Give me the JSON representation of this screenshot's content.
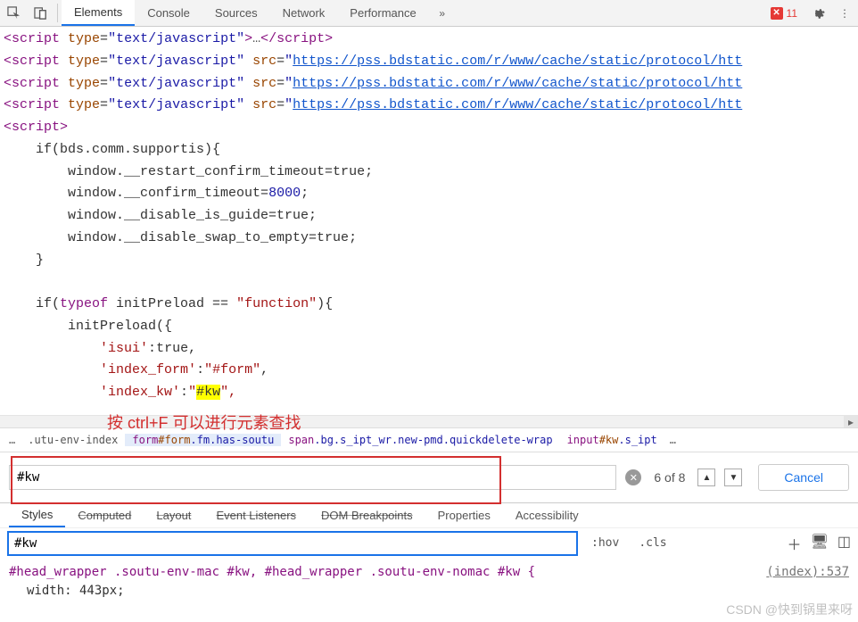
{
  "toolbar": {
    "tabs": [
      "Elements",
      "Console",
      "Sources",
      "Network",
      "Performance"
    ],
    "active_tab": 0,
    "errors": "11"
  },
  "code": {
    "lines": [
      {
        "t": "scriptjs",
        "ell": true,
        "src": null
      },
      {
        "t": "scriptjs",
        "src": "https://pss.bdstatic.com/r/www/cache/static/protocol/htt"
      },
      {
        "t": "scriptjs",
        "src": "https://pss.bdstatic.com/r/www/cache/static/protocol/htt"
      },
      {
        "t": "scriptjs",
        "src": "https://pss.bdstatic.com/r/www/cache/static/protocol/htt"
      },
      {
        "t": "scriptopen"
      },
      {
        "t": "js",
        "txt": "    if(bds.comm.supportis){"
      },
      {
        "t": "js",
        "txt": "        window.__restart_confirm_timeout=true;"
      },
      {
        "t": "js",
        "txt": "        window.__confirm_timeout=",
        "num": "8000",
        "after": ";"
      },
      {
        "t": "js",
        "txt": "        window.__disable_is_guide=true;"
      },
      {
        "t": "js",
        "txt": "        window.__disable_swap_to_empty=true;"
      },
      {
        "t": "js",
        "txt": "    }"
      },
      {
        "t": "blank"
      },
      {
        "t": "js2",
        "pre": "    if(",
        "kw": "typeof",
        "mid": " initPreload == ",
        "str": "\"function\"",
        "post": "){"
      },
      {
        "t": "js",
        "txt": "        initPreload({"
      },
      {
        "t": "kv",
        "k": "'isui'",
        "v": "true",
        "vtype": "bool"
      },
      {
        "t": "kv",
        "k": "'index_form'",
        "v": "\"#form\"",
        "vtype": "str"
      },
      {
        "t": "kvhl",
        "k": "'index_kw'",
        "pre": "\"",
        "hl": "#kw",
        "post": "\","
      }
    ]
  },
  "annotation": "按 ctrl+F 可以进行元素查找",
  "breadcrumb": {
    "items": [
      {
        "txt": ".utu-env-index",
        "active": false
      },
      {
        "html": "<span class='bc-tag'>form</span><span class='bc-id'>#form</span><span class='bc-cls'>.fm.has-soutu</span>",
        "active": true
      },
      {
        "html": "<span class='bc-tag'>span</span><span class='bc-cls'>.bg.s_ipt_wr.new-pmd.quickdelete-wrap</span>",
        "active": false
      },
      {
        "html": "<span class='bc-tag'>input</span><span class='bc-id'>#kw</span><span class='bc-cls'>.s_ipt</span>",
        "active": false
      }
    ]
  },
  "search": {
    "value": "#kw",
    "count": "6 of 8",
    "cancel": "Cancel"
  },
  "styles_tabs": [
    "Styles",
    "Computed",
    "Layout",
    "Event Listeners",
    "DOM Breakpoints",
    "Properties",
    "Accessibility"
  ],
  "filter": {
    "value": "#kw",
    "hov": ":hov",
    "cls": ".cls"
  },
  "css": {
    "selector": "#head_wrapper .soutu-env-mac #kw, #head_wrapper .soutu-env-nomac #kw {",
    "src": "(index):537",
    "prop": "width: 443px;"
  },
  "watermark": "CSDN @快到锅里来呀"
}
